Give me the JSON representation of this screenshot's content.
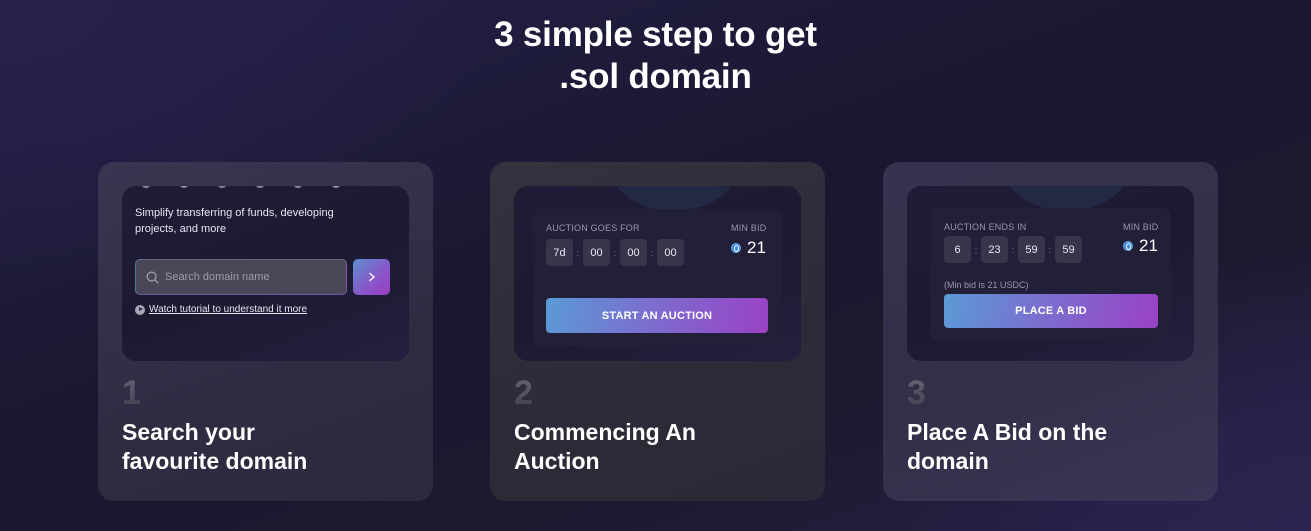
{
  "heading": {
    "line1": "3 simple step to get",
    "line2": ".sol domain"
  },
  "steps": [
    {
      "number": "1",
      "title_line1": "Search your",
      "title_line2": "favourite domain",
      "preview": {
        "description": "Simplify transferring of funds, developing projects, and more",
        "search_placeholder": "Search domain name",
        "search_value": "",
        "go_icon": "chevron-right-icon",
        "tutorial_link": "Watch tutorial to understand it more"
      }
    },
    {
      "number": "2",
      "title_line1": "Commencing An",
      "title_line2": "Auction",
      "preview": {
        "timer_label": "AUCTION GOES FOR",
        "timer": [
          "7d",
          "00",
          "00",
          "00"
        ],
        "min_bid_label": "MIN BID",
        "min_bid_value": "21",
        "currency_icon": "usdc-icon",
        "button_label": "START AN AUCTION"
      }
    },
    {
      "number": "3",
      "title_line1": "Place A Bid on the",
      "title_line2": "domain",
      "preview": {
        "timer_label": "AUCTION ENDS IN",
        "timer": [
          "6",
          "23",
          "59",
          "59"
        ],
        "min_bid_label": "MIN BID",
        "min_bid_value": "21",
        "currency_icon": "usdc-icon",
        "note": "(Min bid is 21 USDC)",
        "button_label": "PLACE A BID"
      }
    }
  ],
  "colors": {
    "accent_gradient_start": "#5b9ad6",
    "accent_gradient_end": "#9a42c4",
    "background": "#1b1a2e",
    "card": "#2f2d40"
  }
}
